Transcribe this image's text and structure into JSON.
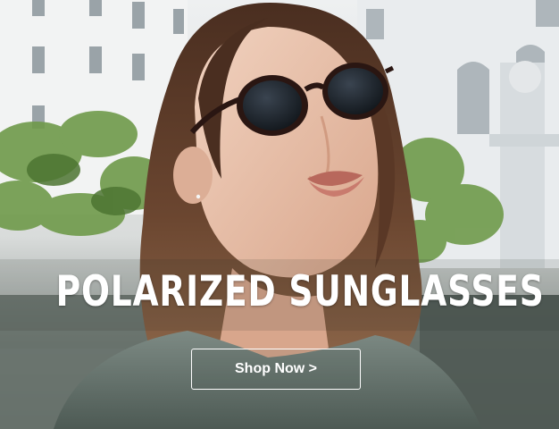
{
  "banner": {
    "headline": "POLARIZED SUNGLASSES",
    "cta_label": "Shop Now >"
  },
  "colors": {
    "text": "#ffffff",
    "sky": "#e6eaec",
    "foliage": "#6f9a4a",
    "hair": "#5a3a28",
    "skin": "#e8c2ac",
    "lenses": "#1c2228",
    "frames": "#2a1612"
  }
}
